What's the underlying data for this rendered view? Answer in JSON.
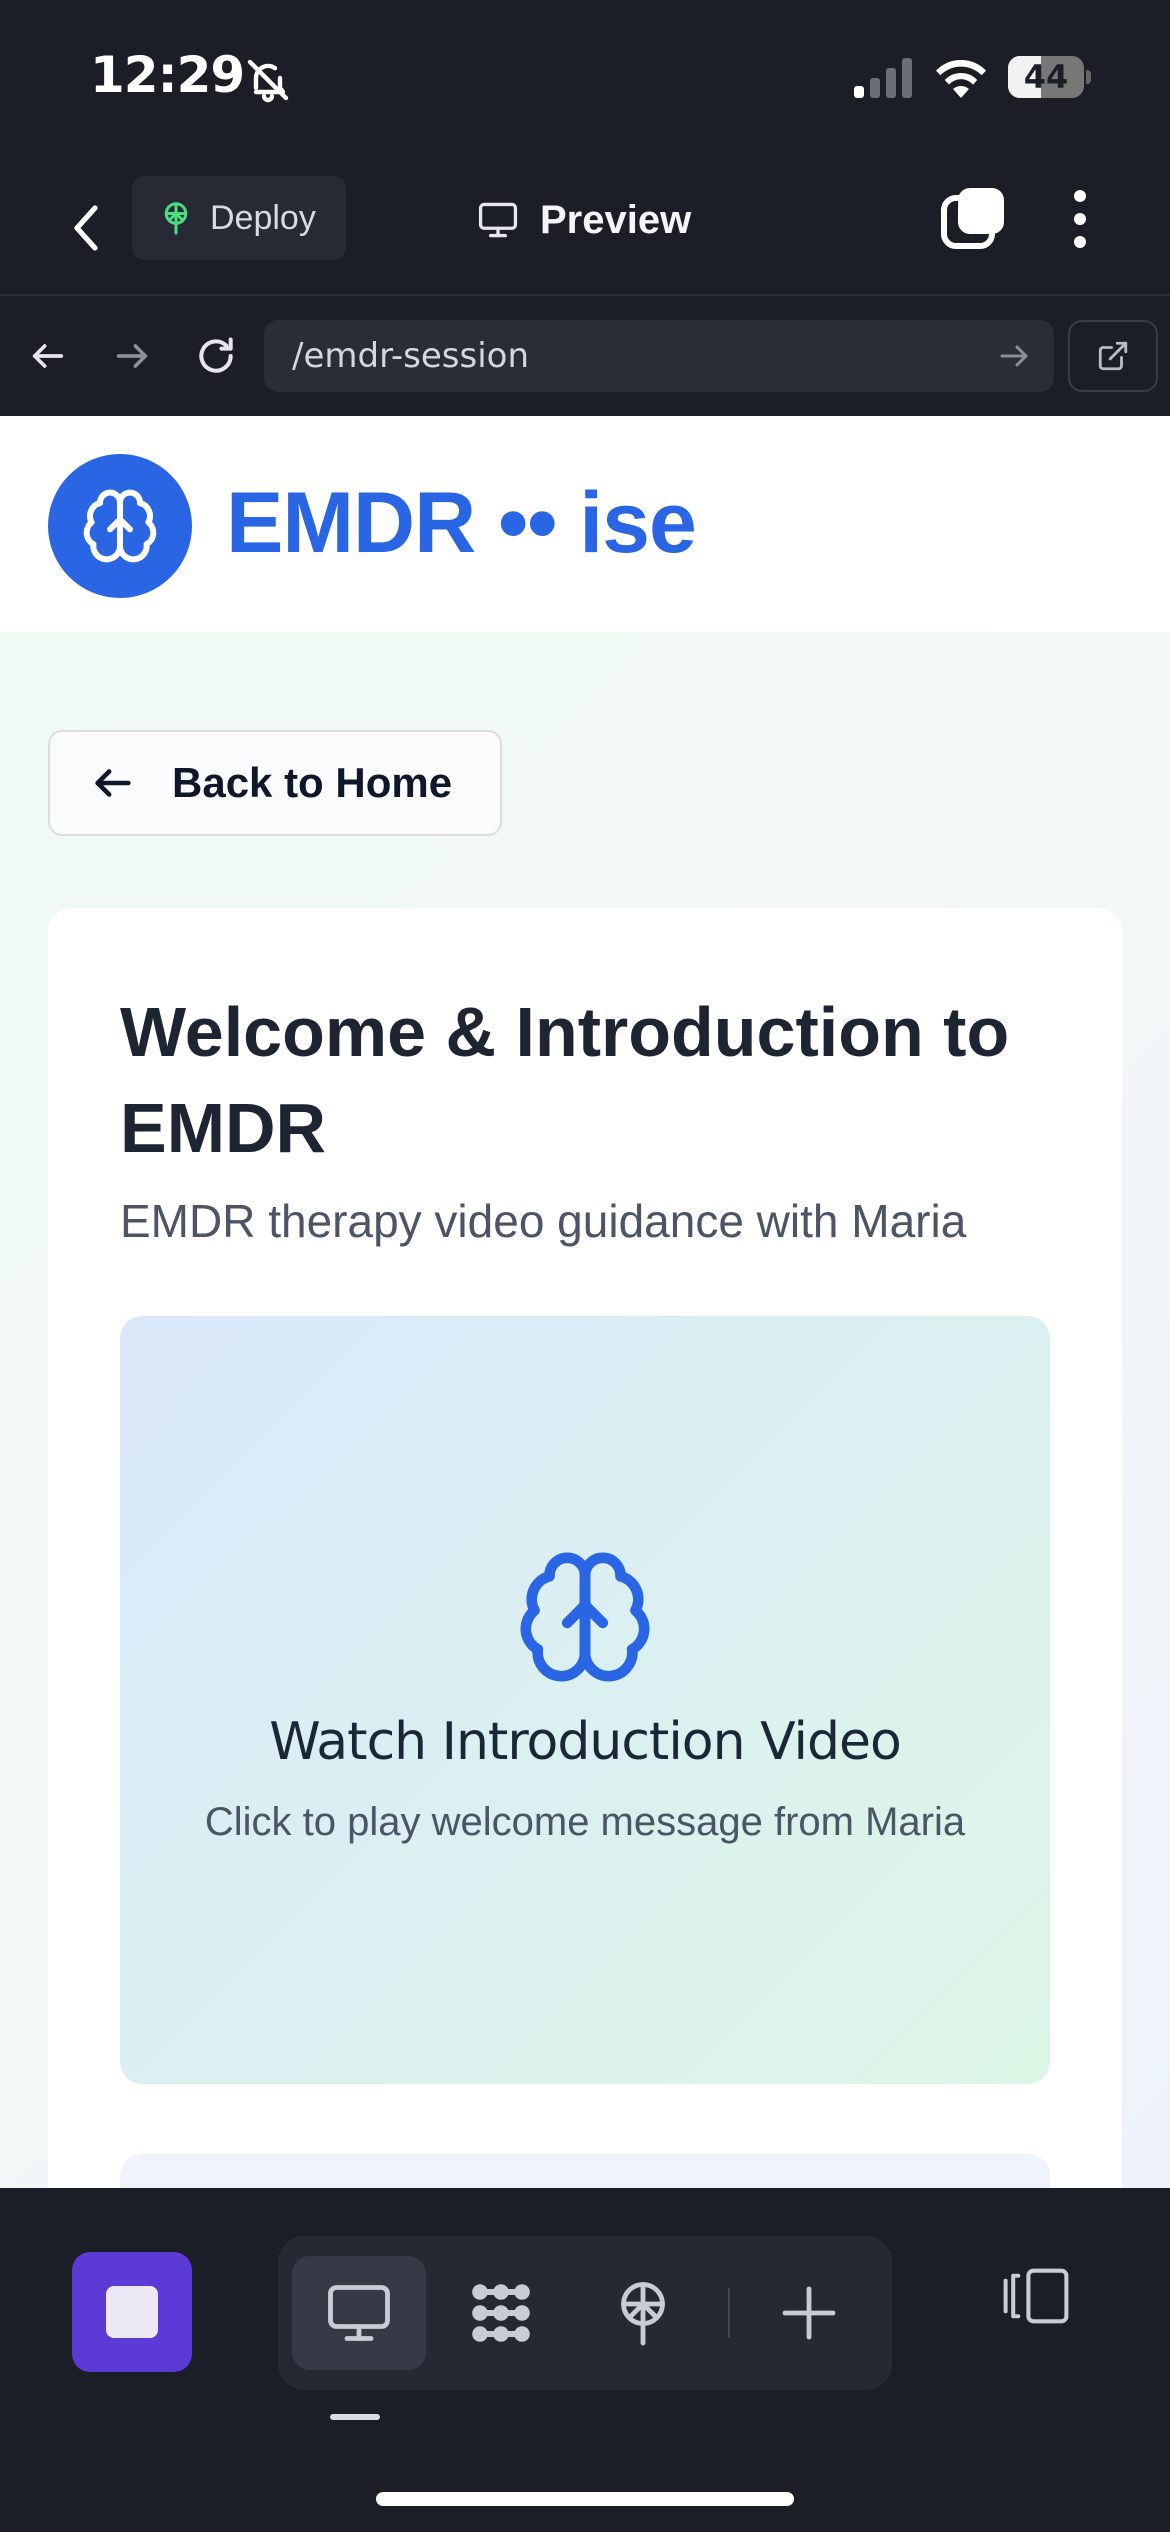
{
  "status_bar": {
    "time": "12:29",
    "battery_level": "44",
    "battery_fraction": 0.44
  },
  "app_toolbar": {
    "deploy_label": "Deploy",
    "preview_label": "Preview"
  },
  "browser": {
    "url": "/emdr-session"
  },
  "site": {
    "brand": "EMDR •• ise",
    "brand_color": "#2a66e4"
  },
  "page": {
    "back_label": "Back to Home",
    "title": "Welcome & Introduction to EMDR",
    "subtitle": "EMDR therapy video guidance with Maria",
    "video": {
      "title": "Watch Introduction Video",
      "subtitle": "Click to play welcome message from Maria",
      "icon": "brain-icon"
    }
  },
  "bottom_toolbar": {
    "stop_color": "#5b3ad6",
    "tools": [
      "monitor-icon",
      "apps-icon",
      "deploy-icon",
      "plus-icon"
    ],
    "active_tool": "monitor-icon"
  }
}
